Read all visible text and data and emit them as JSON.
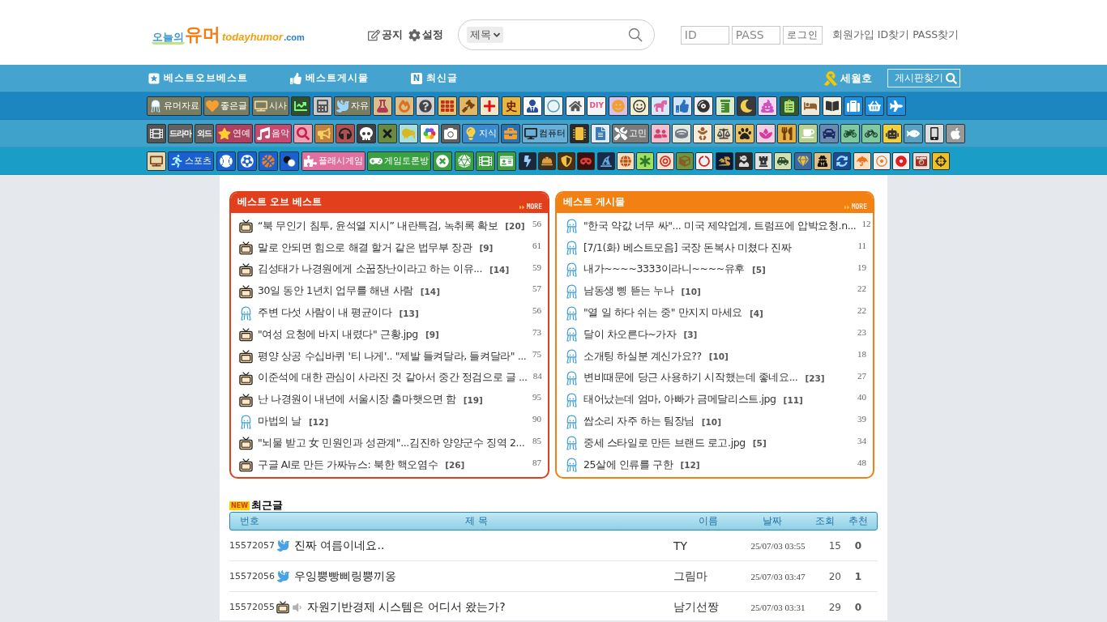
{
  "header": {
    "logo": {
      "prefix": "오늘의",
      "name": "유머",
      "domain": "todayhumor",
      "tld": ".com"
    },
    "links": [
      {
        "kind": "notice",
        "label": "공지"
      },
      {
        "kind": "settings",
        "label": "설정"
      }
    ],
    "search": {
      "scope": "제목"
    },
    "login": {
      "id_placeholder": "ID",
      "password_placeholder": "PASS",
      "button": "로그인"
    },
    "account_links": [
      "회원가입",
      "ID찾기",
      "PASS찾기"
    ]
  },
  "nav": {
    "items": [
      {
        "kind": "star",
        "label": "베스트오브베스트"
      },
      {
        "kind": "thumb",
        "label": "베스트게시물"
      },
      {
        "kind": "badge",
        "badge": "N",
        "label": "최신글"
      }
    ],
    "memorial": "세월호",
    "board_search": "게시판찾기"
  },
  "board_rows": [
    [
      {
        "kind": "labeled",
        "label": "유머자료"
      },
      {
        "kind": "labeled",
        "label": "좋은글"
      },
      {
        "kind": "labeled",
        "label": "시사"
      },
      {
        "kind": "icon"
      },
      {
        "kind": "icon"
      },
      {
        "kind": "labeled",
        "label": "자유"
      },
      {
        "kind": "icon"
      },
      {
        "kind": "icon"
      },
      {
        "kind": "icon"
      },
      {
        "kind": "icon"
      },
      {
        "kind": "icon"
      },
      {
        "kind": "icon"
      },
      {
        "kind": "glyph",
        "label": "史"
      },
      {
        "kind": "icon"
      },
      {
        "kind": "icon"
      },
      {
        "kind": "icon"
      },
      {
        "kind": "glyph",
        "label": "DIY"
      },
      {
        "kind": "icon"
      },
      {
        "kind": "icon"
      },
      {
        "kind": "icon"
      },
      {
        "kind": "icon"
      },
      {
        "kind": "icon"
      },
      {
        "kind": "icon"
      },
      {
        "kind": "icon"
      },
      {
        "kind": "icon"
      },
      {
        "kind": "icon"
      },
      {
        "kind": "icon"
      },
      {
        "kind": "icon"
      },
      {
        "kind": "icon"
      },
      {
        "kind": "icon"
      },
      {
        "kind": "icon"
      }
    ],
    [
      {
        "kind": "icon"
      },
      {
        "kind": "glyph",
        "label": "드라마"
      },
      {
        "kind": "glyph",
        "label": "외드"
      },
      {
        "kind": "labeled",
        "label": "연예"
      },
      {
        "kind": "labeled",
        "label": "음악"
      },
      {
        "kind": "icon"
      },
      {
        "kind": "icon"
      },
      {
        "kind": "icon"
      },
      {
        "kind": "icon"
      },
      {
        "kind": "icon"
      },
      {
        "kind": "icon"
      },
      {
        "kind": "icon"
      },
      {
        "kind": "icon"
      },
      {
        "kind": "labeled",
        "label": "지식"
      },
      {
        "kind": "icon"
      },
      {
        "kind": "labeled",
        "label": "컴퓨터"
      },
      {
        "kind": "icon"
      },
      {
        "kind": "icon"
      },
      {
        "kind": "labeled",
        "label": "고민"
      },
      {
        "kind": "icon"
      },
      {
        "kind": "icon"
      },
      {
        "kind": "icon"
      },
      {
        "kind": "icon"
      },
      {
        "kind": "icon"
      },
      {
        "kind": "icon"
      },
      {
        "kind": "icon"
      },
      {
        "kind": "icon"
      },
      {
        "kind": "icon"
      },
      {
        "kind": "icon"
      },
      {
        "kind": "icon"
      },
      {
        "kind": "icon"
      },
      {
        "kind": "icon"
      },
      {
        "kind": "icon"
      },
      {
        "kind": "icon"
      }
    ],
    [
      {
        "kind": "icon"
      },
      {
        "kind": "labeled",
        "label": "스포츠"
      },
      {
        "kind": "icon"
      },
      {
        "kind": "icon"
      },
      {
        "kind": "icon"
      },
      {
        "kind": "icon"
      },
      {
        "kind": "labeled",
        "label": "플래시게임"
      },
      {
        "kind": "labeled",
        "label": "게임토론방"
      },
      {
        "kind": "icon"
      },
      {
        "kind": "icon"
      },
      {
        "kind": "icon"
      },
      {
        "kind": "icon"
      },
      {
        "kind": "icon"
      },
      {
        "kind": "icon"
      },
      {
        "kind": "icon"
      },
      {
        "kind": "icon"
      },
      {
        "kind": "icon"
      },
      {
        "kind": "icon"
      },
      {
        "kind": "icon"
      },
      {
        "kind": "icon"
      },
      {
        "kind": "icon"
      },
      {
        "kind": "icon"
      },
      {
        "kind": "icon"
      },
      {
        "kind": "icon"
      },
      {
        "kind": "icon"
      },
      {
        "kind": "icon"
      },
      {
        "kind": "icon"
      },
      {
        "kind": "icon"
      },
      {
        "kind": "icon"
      },
      {
        "kind": "icon"
      },
      {
        "kind": "icon"
      },
      {
        "kind": "icon"
      },
      {
        "kind": "icon"
      },
      {
        "kind": "icon"
      }
    ]
  ],
  "best_panels": [
    {
      "title": "베스트 오브 베스트",
      "more": "MORE",
      "color": "#e2401c",
      "rows": [
        {
          "kind": "tv",
          "title": "“북 무인기 침투, 윤석열 지시” 내란특검, 녹취록 확보",
          "comments": "[20]",
          "count": "56"
        },
        {
          "kind": "tv",
          "title": "말로 안되면 힘으로 해결 할거 같은 법무부 장관",
          "comments": "[9]",
          "count": "61"
        },
        {
          "kind": "tv",
          "title": "김성태가 나경원에게 소꿉장난이라고 하는 이유...",
          "comments": "[14]",
          "count": "59"
        },
        {
          "kind": "tv",
          "title": "30일 동안 1년치 업무를 해낸 사람",
          "comments": "[14]",
          "count": "57"
        },
        {
          "kind": "humor",
          "title": "주변 다섯 사람이 내 평균이다",
          "comments": "[13]",
          "count": "56"
        },
        {
          "kind": "tv",
          "title": "\"여성 요청에 바지 내렸다\" 근황.jpg",
          "comments": "[9]",
          "count": "73"
        },
        {
          "kind": "tv",
          "title": "평양 상공 수십바퀴 '티 나게'.. \"제발 들켜달라, 들켜달라\" ...",
          "count": "75"
        },
        {
          "kind": "tv",
          "title": "이준석에 대한 관심이 사라진 것 같아서 중간 정검으로 글 ...",
          "count": "84"
        },
        {
          "kind": "tv",
          "title": "난 나경원이 내년에 서울시장 출마햇으면 함",
          "comments": "[19]",
          "count": "95"
        },
        {
          "kind": "humor",
          "title": "마법의 날",
          "comments": "[12]",
          "count": "90"
        },
        {
          "kind": "tv",
          "title": "\"뇌물 받고 女 민원인과 성관계\"...김진하 양양군수 징역 2...",
          "count": "85"
        },
        {
          "kind": "tv",
          "title": "구글 AI로 만든 가짜뉴스: 북한 핵오염수",
          "comments": "[26]",
          "count": "87"
        }
      ]
    },
    {
      "title": "베스트 게시물",
      "more": "MORE",
      "color": "#f38012",
      "rows": [
        {
          "kind": "humor",
          "title": "\"한국 약값 너무 싸\"... 미국 제약업계, 트럼프에 압박요청.n...",
          "count": "12"
        },
        {
          "kind": "humor",
          "title": "[7/1(화) 베스트모음] 국장 돈복사 미쳤다 진짜",
          "count": "11"
        },
        {
          "kind": "humor",
          "title": "내가~~~~3333이라니~~~~유후",
          "comments": "[5]",
          "count": "19"
        },
        {
          "kind": "humor",
          "title": "남동생 삥 뜯는 누나",
          "comments": "[10]",
          "count": "22"
        },
        {
          "kind": "humor",
          "title": "\"열 일 하다 쉬는 중\" 만지지 마세요",
          "comments": "[4]",
          "count": "22"
        },
        {
          "kind": "humor",
          "title": "달이 차오른다~가자",
          "comments": "[3]",
          "count": "23"
        },
        {
          "kind": "humor",
          "title": "소개팅 하실분 계신가요??",
          "comments": "[10]",
          "count": "18"
        },
        {
          "kind": "humor",
          "title": "변비때문에 당근 사용하기 시작했는데 좋네요...",
          "comments": "[23]",
          "count": "27"
        },
        {
          "kind": "humor",
          "title": "태어났는데 엄마, 아빠가 금메달리스트.jpg",
          "comments": "[11]",
          "count": "40"
        },
        {
          "kind": "humor",
          "title": "쌉소리 자주 하는 팀장님",
          "comments": "[10]",
          "count": "39"
        },
        {
          "kind": "humor",
          "title": "중세 스타일로 만든 브랜드 로고.jpg",
          "comments": "[5]",
          "count": "34"
        },
        {
          "kind": "humor",
          "title": "25살에 인류를 구한",
          "comments": "[12]",
          "count": "48"
        }
      ]
    }
  ],
  "recent": {
    "badge": "NEW",
    "title": "최근글",
    "columns": [
      "번호",
      "제 목",
      "이름",
      "날짜",
      "조회",
      "추천"
    ],
    "rows": [
      {
        "number": "15572057",
        "kind": "bird",
        "has_audio": false,
        "title": "진짜 여름이네요..",
        "author": "TY",
        "date": "25/07/03 03:55",
        "views": "15",
        "recommends": "0"
      },
      {
        "number": "15572056",
        "kind": "bird",
        "has_audio": false,
        "title": "우잉뿡빵삐링뿡끼옹",
        "author": "그림마",
        "date": "25/07/03 03:47",
        "views": "20",
        "recommends": "1"
      },
      {
        "number": "15572055",
        "kind": "tv",
        "has_audio": true,
        "title": "자원기반경제 시스템은 어디서 왔는가?",
        "author": "남기선짱",
        "date": "25/07/03 03:31",
        "views": "29",
        "recommends": "0"
      }
    ]
  }
}
